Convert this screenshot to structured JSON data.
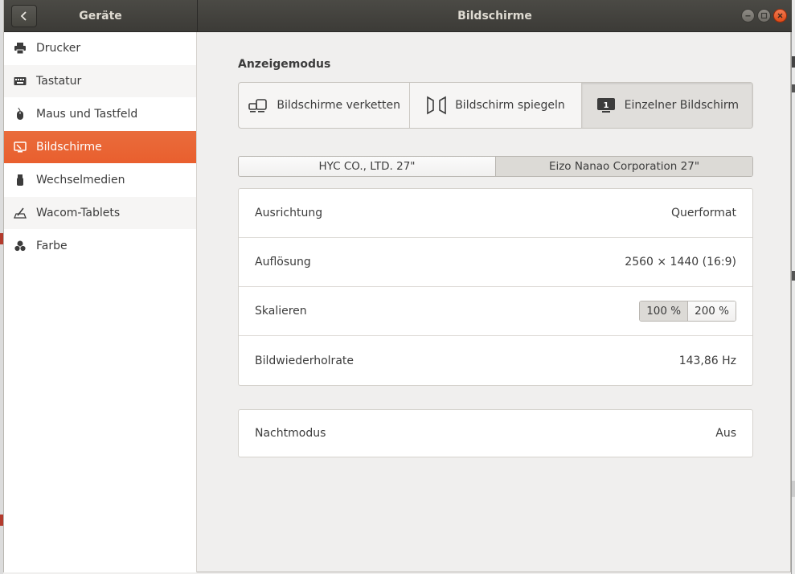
{
  "window": {
    "left_title": "Geräte",
    "title": "Bildschirme"
  },
  "sidebar": {
    "items": [
      {
        "label": "Drucker",
        "icon": "printer-icon"
      },
      {
        "label": "Tastatur",
        "icon": "keyboard-icon"
      },
      {
        "label": "Maus und Tastfeld",
        "icon": "mouse-icon"
      },
      {
        "label": "Bildschirme",
        "icon": "display-icon",
        "active": true
      },
      {
        "label": "Wechselmedien",
        "icon": "usb-icon"
      },
      {
        "label": "Wacom-Tablets",
        "icon": "tablet-icon"
      },
      {
        "label": "Farbe",
        "icon": "color-icon"
      }
    ]
  },
  "main": {
    "section_title": "Anzeigemodus",
    "modes": [
      {
        "label": "Bildschirme verketten",
        "icon": "join-displays-icon"
      },
      {
        "label": "Bildschirm spiegeln",
        "icon": "mirror-display-icon"
      },
      {
        "label": "Einzelner Bildschirm",
        "icon": "single-display-icon",
        "active": true
      }
    ],
    "monitors": [
      {
        "label": "HYC CO., LTD. 27\""
      },
      {
        "label": "Eizo Nanao Corporation 27\"",
        "active": true
      }
    ],
    "settings": {
      "orientation": {
        "label": "Ausrichtung",
        "value": "Querformat"
      },
      "resolution": {
        "label": "Auflösung",
        "value": "2560 × 1440 (16:9)"
      },
      "scale": {
        "label": "Skalieren",
        "options": [
          "100 %",
          "200 %"
        ],
        "selected": "100 %"
      },
      "refresh": {
        "label": "Bildwiederholrate",
        "value": "143,86 Hz"
      }
    },
    "night_mode": {
      "label": "Nachtmodus",
      "value": "Aus"
    }
  },
  "colors": {
    "accent": "#e95420",
    "headerbar": "#3c3b37",
    "background": "#f0efee"
  }
}
